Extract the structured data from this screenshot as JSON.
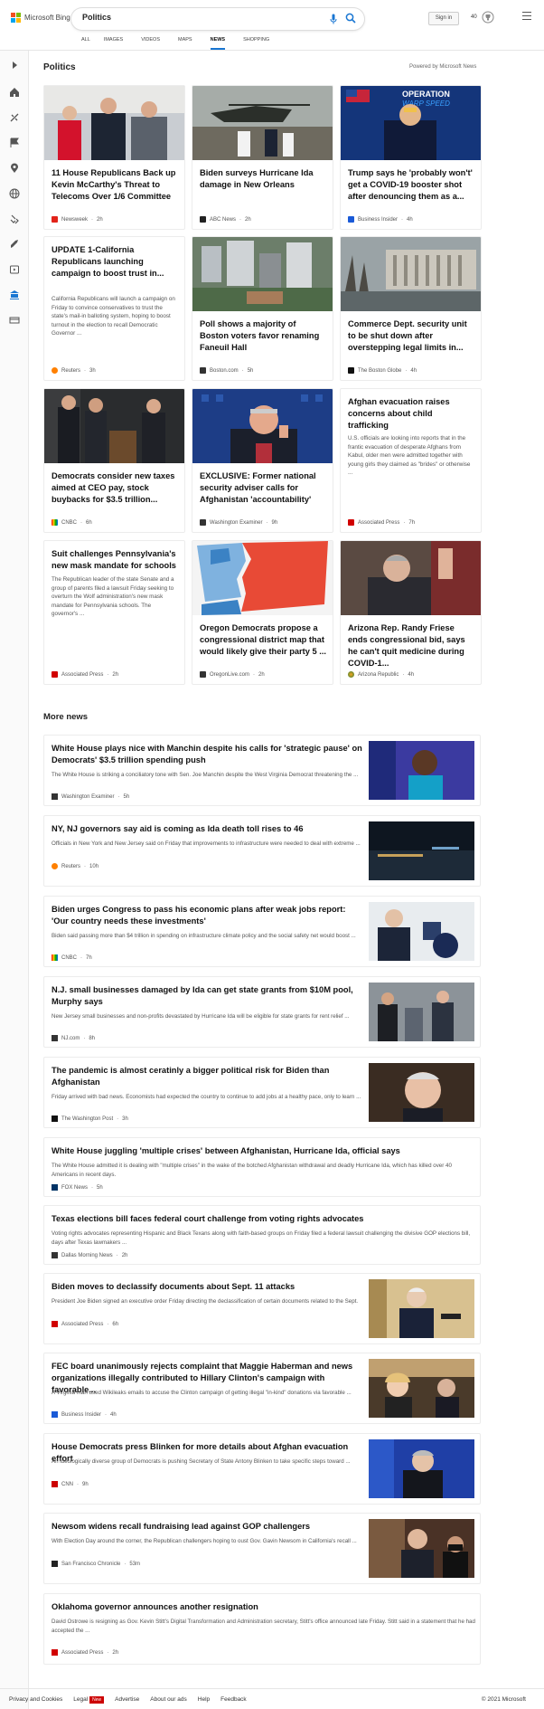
{
  "brand": "Microsoft Bing",
  "search": {
    "value": "Politics"
  },
  "header": {
    "signin": "Sign in",
    "rewards": "40"
  },
  "tabs": [
    "ALL",
    "IMAGES",
    "VIDEOS",
    "MAPS",
    "NEWS",
    "SHOPPING"
  ],
  "active_tab": "NEWS",
  "section_title": "Politics",
  "powered": "Powered by Microsoft News",
  "cards": [
    {
      "title": "11 House Republicans Back up Kevin McCarthy's Threat to Telecoms Over 1/6 Committee",
      "source": "Newsweek",
      "time": "2h"
    },
    {
      "title": "Biden surveys Hurricane Ida damage in New Orleans",
      "source": "ABC News",
      "time": "2h"
    },
    {
      "title": "Trump says he 'probably won't' get a COVID-19 booster shot after denouncing them as a...",
      "source": "Business Insider",
      "time": "4h"
    },
    {
      "title": "UPDATE 1-California Republicans launching campaign to boost trust in...",
      "snippet": "California Republicans will launch a campaign on Friday to convince conservatives to trust the state's mail-in balloting system, hoping to boost turnout in the election to recall Democratic Governor ...",
      "source": "Reuters",
      "time": "3h"
    },
    {
      "title": "Poll shows a majority of Boston voters favor renaming Faneuil Hall",
      "source": "Boston.com",
      "time": "5h"
    },
    {
      "title": "Commerce Dept. security unit to be shut down after overstepping legal limits in...",
      "source": "The Boston Globe",
      "time": "4h"
    },
    {
      "title": "Democrats consider new taxes aimed at CEO pay, stock buybacks for $3.5 trillion...",
      "source": "CNBC",
      "time": "6h"
    },
    {
      "title": "EXCLUSIVE: Former national security adviser calls for Afghanistan 'accountability'",
      "source": "Washington Examiner",
      "time": "9h"
    },
    {
      "title": "Afghan evacuation raises concerns about child trafficking",
      "snippet": "U.S. officials are looking into reports that in the frantic evacuation of desperate Afghans from Kabul, older men were admitted together with young girls they claimed as \"brides\" or otherwise ...",
      "source": "Associated Press",
      "time": "7h"
    },
    {
      "title": "Suit challenges Pennsylvania's new mask mandate for schools",
      "snippet": "The Republican leader of the state Senate and a group of parents filed a lawsuit Friday seeking to overturn the Wolf administration's new mask mandate for Pennsylvania schools. The governor's ...",
      "source": "Associated Press",
      "time": "2h"
    },
    {
      "title": "Oregon Democrats propose a congressional district map that would likely give their party 5 ...",
      "source": "OregonLive.com",
      "time": "2h"
    },
    {
      "title": "Arizona Rep. Randy Friese ends congressional bid, says he can't quit medicine during COVID-1...",
      "source": "Arizona Republic",
      "time": "4h"
    }
  ],
  "more_title": "More news",
  "news": [
    {
      "title": "White House plays nice with Manchin despite his calls for 'strategic pause' on Democrats' $3.5 trillion spending push",
      "snippet": "The White House is striking a conciliatory tone with Sen. Joe Manchin despite the West Virginia Democrat threatening the ...",
      "source": "Washington Examiner",
      "time": "5h"
    },
    {
      "title": "NY, NJ governors say aid is coming as Ida death toll rises to 46",
      "snippet": "Officials in New York and New Jersey said on Friday that improvements to infrastructure were needed to deal with extreme ...",
      "source": "Reuters",
      "time": "10h"
    },
    {
      "title": "Biden urges Congress to pass his economic plans after weak jobs report: 'Our country needs these investments'",
      "snippet": "Biden said passing more than $4 trillion in spending on infrastructure climate policy and the social safety net would boost ...",
      "source": "CNBC",
      "time": "7h"
    },
    {
      "title": "N.J. small businesses damaged by Ida can get state grants from $10M pool, Murphy says",
      "snippet": "New Jersey small businesses and non-profits devastated by Hurricane Ida will be eligible for state grants for rent relief ...",
      "source": "NJ.com",
      "time": "8h"
    },
    {
      "title": "The pandemic is almost ceratinly a bigger political risk for Biden than Afghanistan",
      "snippet": "Friday arrived with bad news. Economists had expected the country to continue to add jobs at a healthy pace, only to learn ...",
      "source": "The Washington Post",
      "time": "3h"
    },
    {
      "title": "White House juggling 'multiple crises' between Afghanistan, Hurricane Ida, official says",
      "snippet": "The White House admitted it is dealing with \"multiple crises\" in the wake of the botched Afghanistan withdrawal and deadly Hurricane Ida, which has killed over 40 Americans in recent days.",
      "source": "FOX News",
      "time": "5h"
    },
    {
      "title": "Texas elections bill faces federal court challenge from voting rights advocates",
      "snippet": "Voting rights advocates representing Hispanic and Black Texans along with faith-based groups on Friday filed a federal lawsuit challenging the divisive GOP elections bill, days after Texas lawmakers ...",
      "source": "Dallas Morning News",
      "time": "2h"
    },
    {
      "title": "Biden moves to declassify documents about Sept. 11 attacks",
      "snippet": "President Joe Biden signed an executive order Friday directing the declassification of certain documents related to the Sept.",
      "source": "Associated Press",
      "time": "6h"
    },
    {
      "title": "FEC board unanimously rejects complaint that Maggie Haberman and news organizations illegally contributed to Hillary Clinton's campaign with favorable...",
      "snippet": "A Virginia man used Wikileaks emails to accuse the Clinton campaign of getting illegal \"in-kind\" donations via favorable ...",
      "source": "Business Insider",
      "time": "4h"
    },
    {
      "title": "House Democrats press Blinken for more details about Afghan evacuation effort",
      "snippet": "An ideologically diverse group of Democrats is pushing Secretary of State Antony Blinken to take specific steps toward ...",
      "source": "CNN",
      "time": "9h"
    },
    {
      "title": "Newsom widens recall fundraising lead against GOP challengers",
      "snippet": "With Election Day around the corner, the Republican challengers hoping to oust Gov. Gavin Newsom in California's recall ...",
      "source": "San Francisco Chronicle",
      "time": "53m"
    },
    {
      "title": "Oklahoma governor announces another resignation",
      "snippet": "David Ostrowe is resigning as Gov. Kevin Stitt's Digital Transformation and Administration secretary, Stitt's office announced late Friday. Stitt said in a statement that he had accepted the ...",
      "source": "Associated Press",
      "time": "2h"
    }
  ],
  "footer": {
    "links": [
      "Privacy and Cookies",
      "Legal",
      "Advertise",
      "About our ads",
      "Help",
      "Feedback"
    ],
    "new_badge": "New",
    "copyright": "© 2021 Microsoft"
  },
  "colors": {
    "accent": "#1976d2",
    "bing_red": "#f25022",
    "bing_green": "#7fba00",
    "bing_blue": "#00a4ef",
    "bing_yellow": "#ffb900"
  }
}
